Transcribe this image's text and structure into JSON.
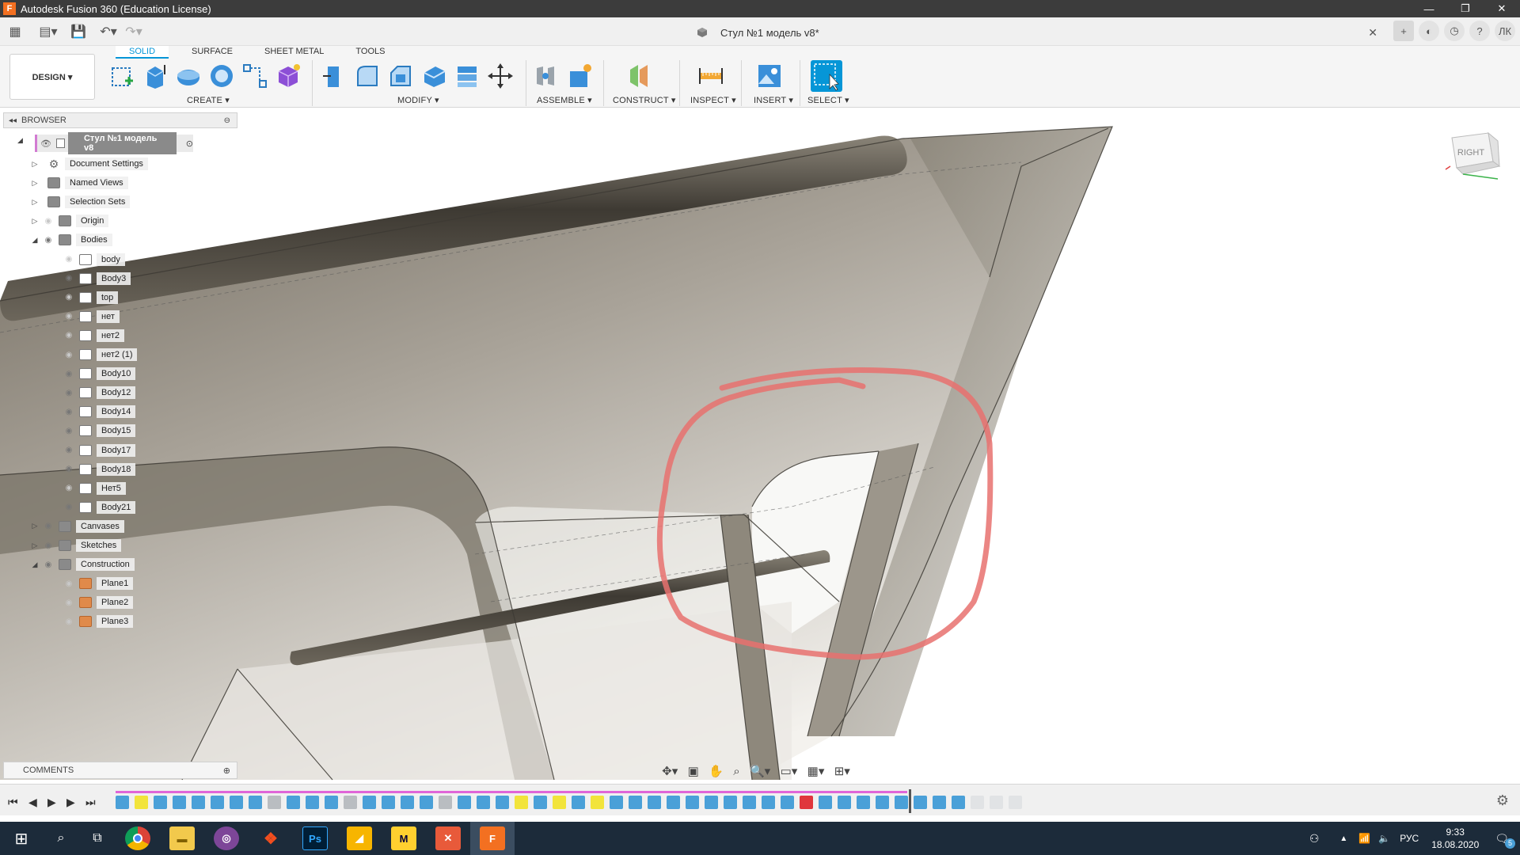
{
  "window": {
    "title": "Autodesk Fusion 360 (Education License)",
    "app_icon_letter": "F",
    "controls": [
      "—",
      "❐",
      "✕"
    ]
  },
  "quick_access": {
    "icons": [
      "apps-grid-icon",
      "file-icon",
      "save-icon",
      "undo-icon",
      "redo-icon"
    ]
  },
  "document": {
    "title": "Стул №1 модель v8*"
  },
  "account": {
    "initials": "ЛК"
  },
  "ribbon": {
    "tabs": [
      {
        "label": "SOLID",
        "active": true
      },
      {
        "label": "SURFACE",
        "active": false
      },
      {
        "label": "SHEET METAL",
        "active": false
      },
      {
        "label": "TOOLS",
        "active": false
      }
    ],
    "workspace": "DESIGN ▾",
    "groups": [
      {
        "label": "CREATE ▾"
      },
      {
        "label": "MODIFY ▾"
      },
      {
        "label": "ASSEMBLE ▾"
      },
      {
        "label": "CONSTRUCT ▾"
      },
      {
        "label": "INSPECT ▾"
      },
      {
        "label": "INSERT ▾"
      },
      {
        "label": "SELECT ▾"
      }
    ]
  },
  "browser": {
    "header": "BROWSER",
    "root": "Стул №1 модель v8",
    "items": [
      {
        "label": "Document Settings",
        "kind": "gear"
      },
      {
        "label": "Named Views",
        "kind": "folder"
      },
      {
        "label": "Selection Sets",
        "kind": "folder"
      },
      {
        "label": "Origin",
        "kind": "folder"
      },
      {
        "label": "Bodies",
        "kind": "folder"
      },
      {
        "label": "body",
        "kind": "body"
      },
      {
        "label": "Body3",
        "kind": "body"
      },
      {
        "label": "top",
        "kind": "body"
      },
      {
        "label": "нет",
        "kind": "body"
      },
      {
        "label": "нет2",
        "kind": "body"
      },
      {
        "label": "нет2 (1)",
        "kind": "body"
      },
      {
        "label": "Body10",
        "kind": "body"
      },
      {
        "label": "Body12",
        "kind": "body"
      },
      {
        "label": "Body14",
        "kind": "body"
      },
      {
        "label": "Body15",
        "kind": "body"
      },
      {
        "label": "Body17",
        "kind": "body"
      },
      {
        "label": "Body18",
        "kind": "body"
      },
      {
        "label": "Нет5",
        "kind": "body"
      },
      {
        "label": "Body21",
        "kind": "body"
      },
      {
        "label": "Canvases",
        "kind": "folder"
      },
      {
        "label": "Sketches",
        "kind": "folder"
      },
      {
        "label": "Construction",
        "kind": "folder"
      },
      {
        "label": "Plane1",
        "kind": "plane"
      },
      {
        "label": "Plane2",
        "kind": "plane"
      },
      {
        "label": "Plane3",
        "kind": "plane"
      }
    ]
  },
  "viewcube": {
    "face": "RIGHT"
  },
  "comments": {
    "label": "COMMENTS"
  },
  "timeline": {
    "controls": [
      "⏮",
      "◀",
      "▶",
      "▶",
      "⏭"
    ]
  },
  "taskbar": {
    "language": "РУС",
    "time": "9:33",
    "date": "18.08.2020",
    "notifications": "5"
  },
  "colors": {
    "accent": "#0696d7",
    "brand": "#f37021",
    "annotation": "#e8716f"
  }
}
